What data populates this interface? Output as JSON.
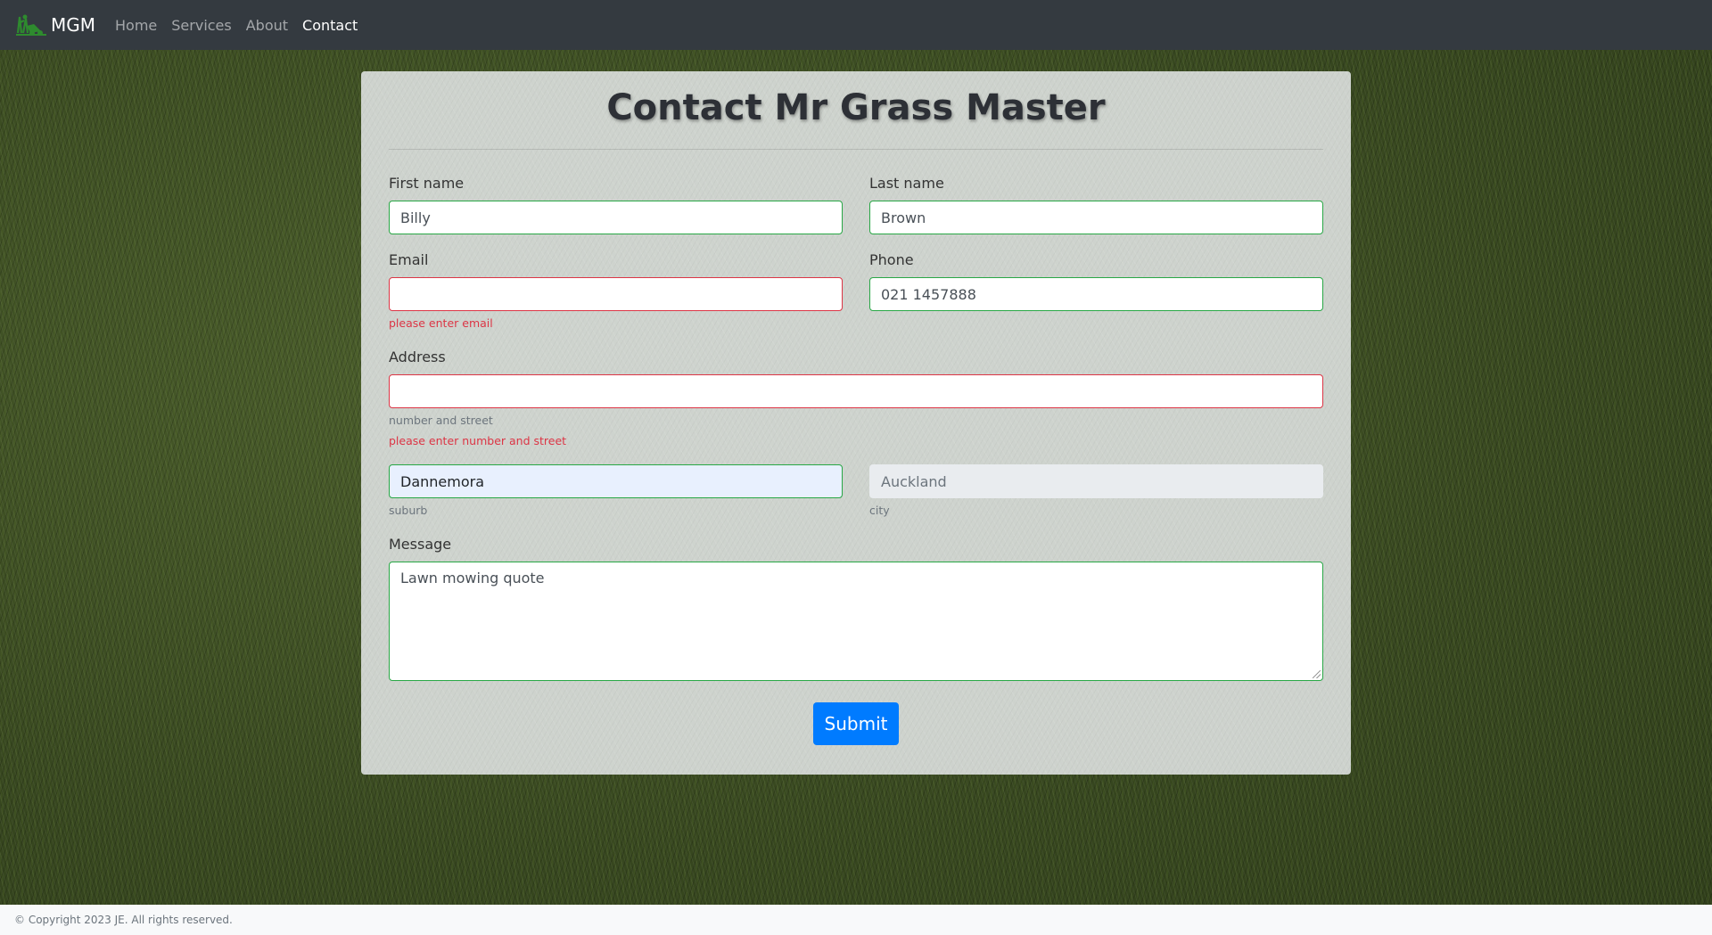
{
  "nav": {
    "brand": "MGM",
    "brand_icon": "lawn-mower-icon",
    "links": [
      {
        "label": "Home",
        "active": false
      },
      {
        "label": "Services",
        "active": false
      },
      {
        "label": "About",
        "active": false
      },
      {
        "label": "Contact",
        "active": true
      }
    ]
  },
  "form": {
    "title": "Contact Mr Grass Master",
    "first_name": {
      "label": "First name",
      "value": "Billy"
    },
    "last_name": {
      "label": "Last name",
      "value": "Brown"
    },
    "email": {
      "label": "Email",
      "value": "",
      "error": "please enter email"
    },
    "phone": {
      "label": "Phone",
      "value": "021 1457888"
    },
    "address": {
      "label": "Address",
      "value": "",
      "help": "number and street",
      "error": "please enter number and street"
    },
    "suburb": {
      "value": "Dannemora",
      "help": "suburb"
    },
    "city": {
      "value": "Auckland",
      "help": "city"
    },
    "message": {
      "label": "Message",
      "value": "Lawn mowing quote"
    },
    "submit_label": "Submit"
  },
  "footer": {
    "text": "© Copyright 2023 JE. All rights reserved."
  },
  "colors": {
    "navbar": "#343a40",
    "valid": "#28a745",
    "invalid": "#dc3545",
    "primary": "#007bff"
  }
}
